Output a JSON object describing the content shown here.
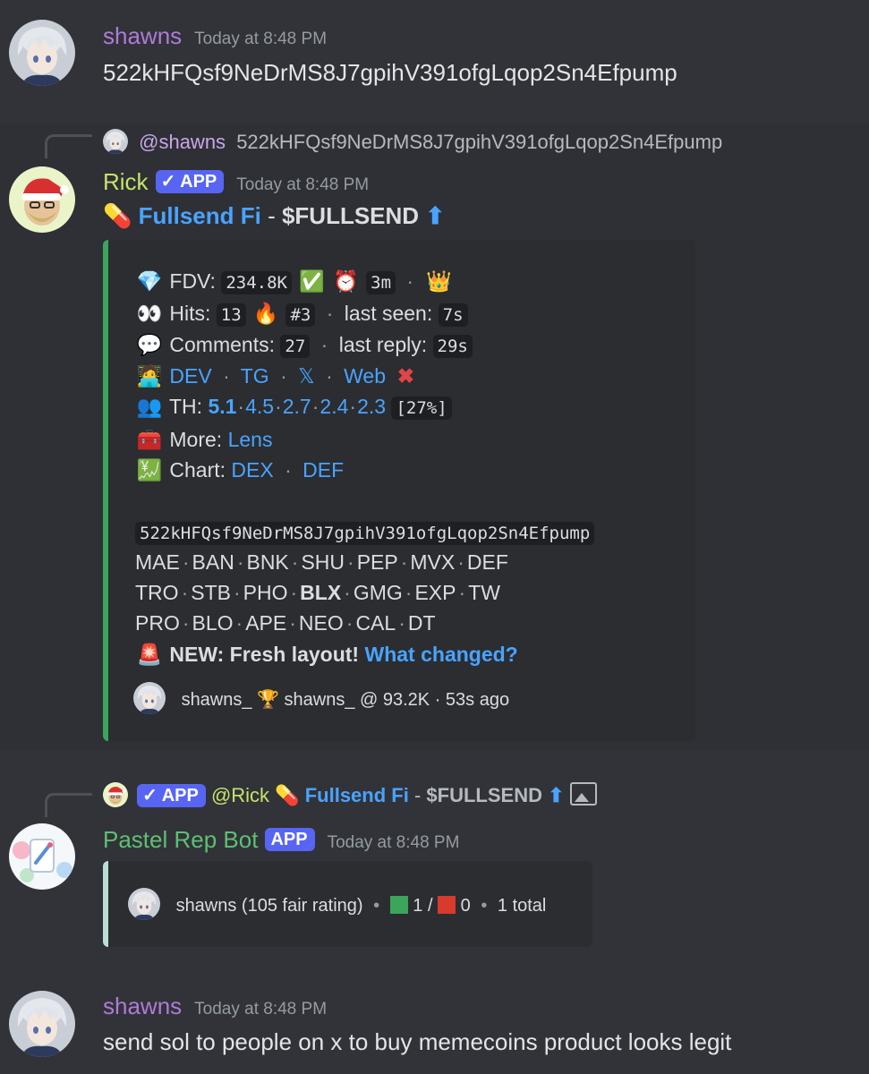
{
  "msg1": {
    "author": "shawns",
    "author_color": "#b07ad8",
    "timestamp": "Today at 8:48 PM",
    "text": "522kHFQsf9NeDrMS8J7gpihV391ofgLqop2Sn4Efpump"
  },
  "msg2": {
    "reply_mention": "@shawns",
    "reply_text": "522kHFQsf9NeDrMS8J7gpihV391ofgLqop2Sn4Efpump",
    "author": "Rick",
    "author_color": "#c6e36a",
    "app_badge": "✓ APP",
    "timestamp": "Today at 8:48 PM",
    "title_name": "Fullsend Fi",
    "title_dash": " - ",
    "title_ticker": "$FULLSEND",
    "embed": {
      "fdv_label": "FDV:",
      "fdv_value": "234.8K",
      "age_value": "3m",
      "hits_label": "Hits:",
      "hits_value": "13",
      "rank_value": "#3",
      "last_seen_label": "last seen:",
      "last_seen_value": "7s",
      "comments_label": "Comments:",
      "comments_value": "27",
      "last_reply_label": "last reply:",
      "last_reply_value": "29s",
      "links": [
        "DEV",
        "TG",
        "𝕏",
        "Web"
      ],
      "th_label": "TH:",
      "th_values": [
        "5.1",
        "4.5",
        "2.7",
        "2.4",
        "2.3"
      ],
      "th_pct": "[27%]",
      "more_label": "More:",
      "more_link": "Lens",
      "chart_label": "Chart:",
      "chart_links": [
        "DEX",
        "DEF"
      ],
      "address": "522kHFQsf9NeDrMS8J7gpihV391ofgLqop2Sn4Efpump",
      "row1": [
        "MAE",
        "BAN",
        "BNK",
        "SHU",
        "PEP",
        "MVX",
        "DEF"
      ],
      "row2": [
        "TRO",
        "STB",
        "PHO",
        "BLX",
        "GMG",
        "EXP",
        "TW"
      ],
      "row3": [
        "PRO",
        "BLO",
        "APE",
        "NEO",
        "CAL",
        "DT"
      ],
      "new_text": "NEW: Fresh layout!",
      "new_link": "What changed?",
      "footer": "shawns_ 🏆 shawns_ @ 93.2K · 53s ago",
      "accent": "#3ba55c"
    }
  },
  "msg3": {
    "reply_badge": "✓ APP",
    "reply_mention": "@Rick",
    "reply_name": "Fullsend Fi",
    "reply_dash": " - ",
    "reply_ticker": "$FULLSEND",
    "author": "Pastel Rep Bot",
    "author_color": "#5fbf72",
    "app_badge": "APP",
    "timestamp": "Today at 8:48 PM",
    "embed_text1": "shawns (105 fair rating)",
    "embed_up": "1",
    "embed_slash": "/",
    "embed_down": "0",
    "embed_total": "1 total",
    "accent": "#b8e0d2"
  },
  "msg4": {
    "author": "shawns",
    "author_color": "#b07ad8",
    "timestamp": "Today at 8:48 PM",
    "text": "send sol to people on x to buy memecoins product looks legit"
  }
}
